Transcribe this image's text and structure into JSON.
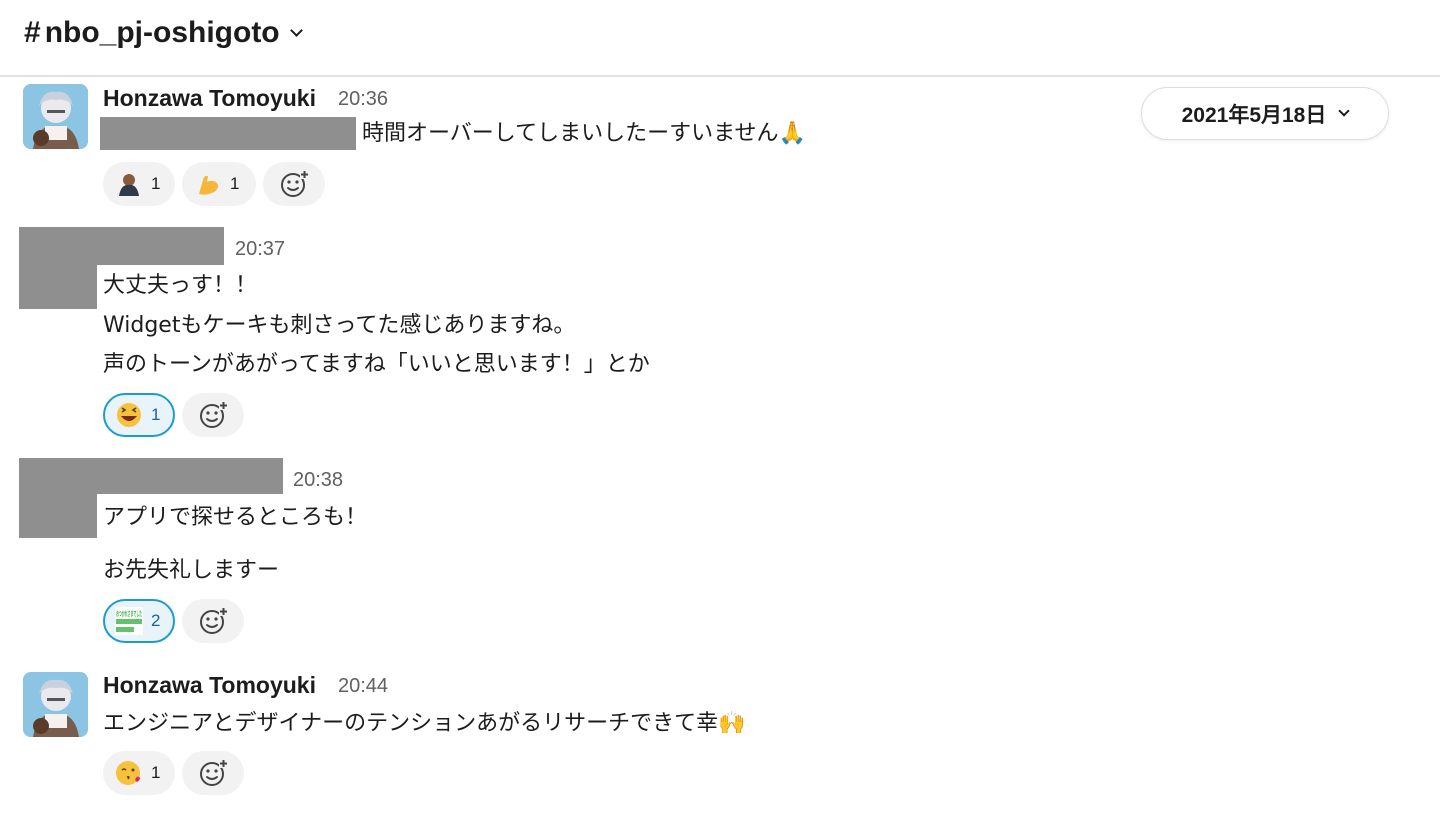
{
  "channel": {
    "hash": "#",
    "name": "nbo_pj-oshigoto"
  },
  "date_jump": {
    "label": "2021年5月18日"
  },
  "messages": [
    {
      "author": "Honzawa Tomoyuki",
      "time": "20:36",
      "lines": [
        "時間オーバーしてしまいしたーすいません🙏"
      ],
      "reactions": [
        {
          "emoji": "person-bowing-emoji",
          "count": "1"
        },
        {
          "emoji": "flexed-biceps-emoji",
          "count": "1"
        }
      ]
    },
    {
      "author": "",
      "time": "20:37",
      "lines": [
        "大丈夫っす！！",
        "Widgetもケーキも刺さってた感じありますね。",
        "声のトーンがあがってますね「いいと思います！」とか"
      ],
      "reactions": [
        {
          "emoji": "laughing-face-emoji",
          "count": "1",
          "active": true
        }
      ]
    },
    {
      "author": "",
      "time": "20:38",
      "lines": [
        "アプリで探せるところも！",
        "お先失礼しますー"
      ],
      "reactions": [
        {
          "emoji": "otsukaresamadeshita-custom-emoji",
          "count": "2",
          "active": true,
          "glyph_text": "おつかれさまでした"
        }
      ]
    },
    {
      "author": "Honzawa Tomoyuki",
      "time": "20:44",
      "lines": [
        "エンジニアとデザイナーのテンションあがるリサーチできて幸🙌"
      ],
      "reactions": [
        {
          "emoji": "face-blowing-kiss-emoji",
          "count": "1"
        }
      ]
    }
  ],
  "icons": {
    "add_reaction": "add-reaction-icon",
    "chevron": "chevron-down-icon"
  }
}
